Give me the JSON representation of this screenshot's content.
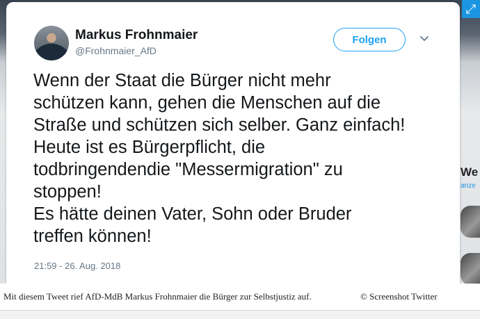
{
  "tweet": {
    "name": "Markus Frohnmaier",
    "handle": "@Frohnmaier_AfD",
    "follow_label": "Folgen",
    "lines": [
      "Wenn der Staat die Bürger nicht mehr",
      "schützen kann, gehen die Menschen auf die",
      "Straße und schützen sich selber. Ganz einfach!",
      "Heute ist es Bürgerpflicht, die",
      "todbringendendie \"Messermigration\" zu",
      "stoppen!",
      "Es hätte deinen Vater, Sohn oder Bruder",
      "treffen können!"
    ],
    "timestamp": "21:59 - 26. Aug. 2018"
  },
  "sidebar": {
    "title": "We",
    "subtitle": "anze"
  },
  "caption": {
    "text": "Mit diesem Tweet rief AfD-MdB Markus Frohnmaier die Bürger zur Selbstjustiz auf.",
    "credit": "© Screenshot Twitter"
  },
  "colors": {
    "accent": "#1da1f2",
    "text": "#14171a",
    "secondary": "#657786"
  },
  "icons": {
    "chevron": "chevron-down-icon",
    "expand": "expand-icon"
  }
}
